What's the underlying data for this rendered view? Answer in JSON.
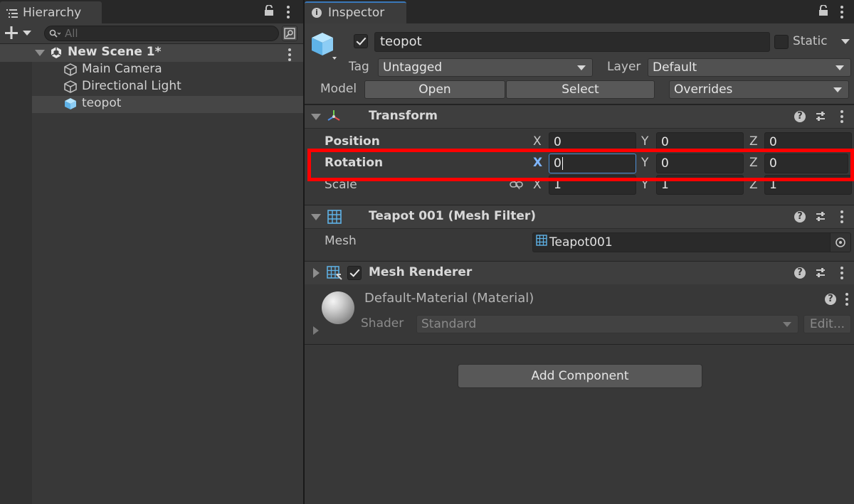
{
  "hierarchy": {
    "tab_label": "Hierarchy",
    "search_placeholder": "All",
    "scene_name": "New Scene 1*",
    "items": [
      {
        "label": "Main Camera"
      },
      {
        "label": "Directional Light"
      },
      {
        "label": "teopot"
      }
    ]
  },
  "inspector": {
    "tab_label": "Inspector",
    "object_name": "teopot",
    "static_label": "Static",
    "tag_label": "Tag",
    "tag_value": "Untagged",
    "layer_label": "Layer",
    "layer_value": "Default",
    "model_label": "Model",
    "open_label": "Open",
    "select_label": "Select",
    "overrides_label": "Overrides",
    "transform": {
      "title": "Transform",
      "position_label": "Position",
      "rotation_label": "Rotation",
      "scale_label": "Scale",
      "x": "X",
      "y": "Y",
      "z": "Z",
      "position": [
        "0",
        "0",
        "0"
      ],
      "rotation": [
        "0",
        "0",
        "0"
      ],
      "scale": [
        "1",
        "1",
        "1"
      ]
    },
    "mesh_filter": {
      "title": "Teapot 001 (Mesh Filter)",
      "mesh_label": "Mesh",
      "mesh_value": "Teapot001"
    },
    "mesh_renderer": {
      "title": "Mesh Renderer"
    },
    "material": {
      "title": "Default-Material (Material)",
      "shader_label": "Shader",
      "shader_value": "Standard",
      "edit_label": "Edit..."
    },
    "add_component_label": "Add Component"
  },
  "colors": {
    "highlight_box": "#ff0000",
    "active_field_border": "#4d8fd6",
    "active_axis": "#7fb6ff"
  }
}
